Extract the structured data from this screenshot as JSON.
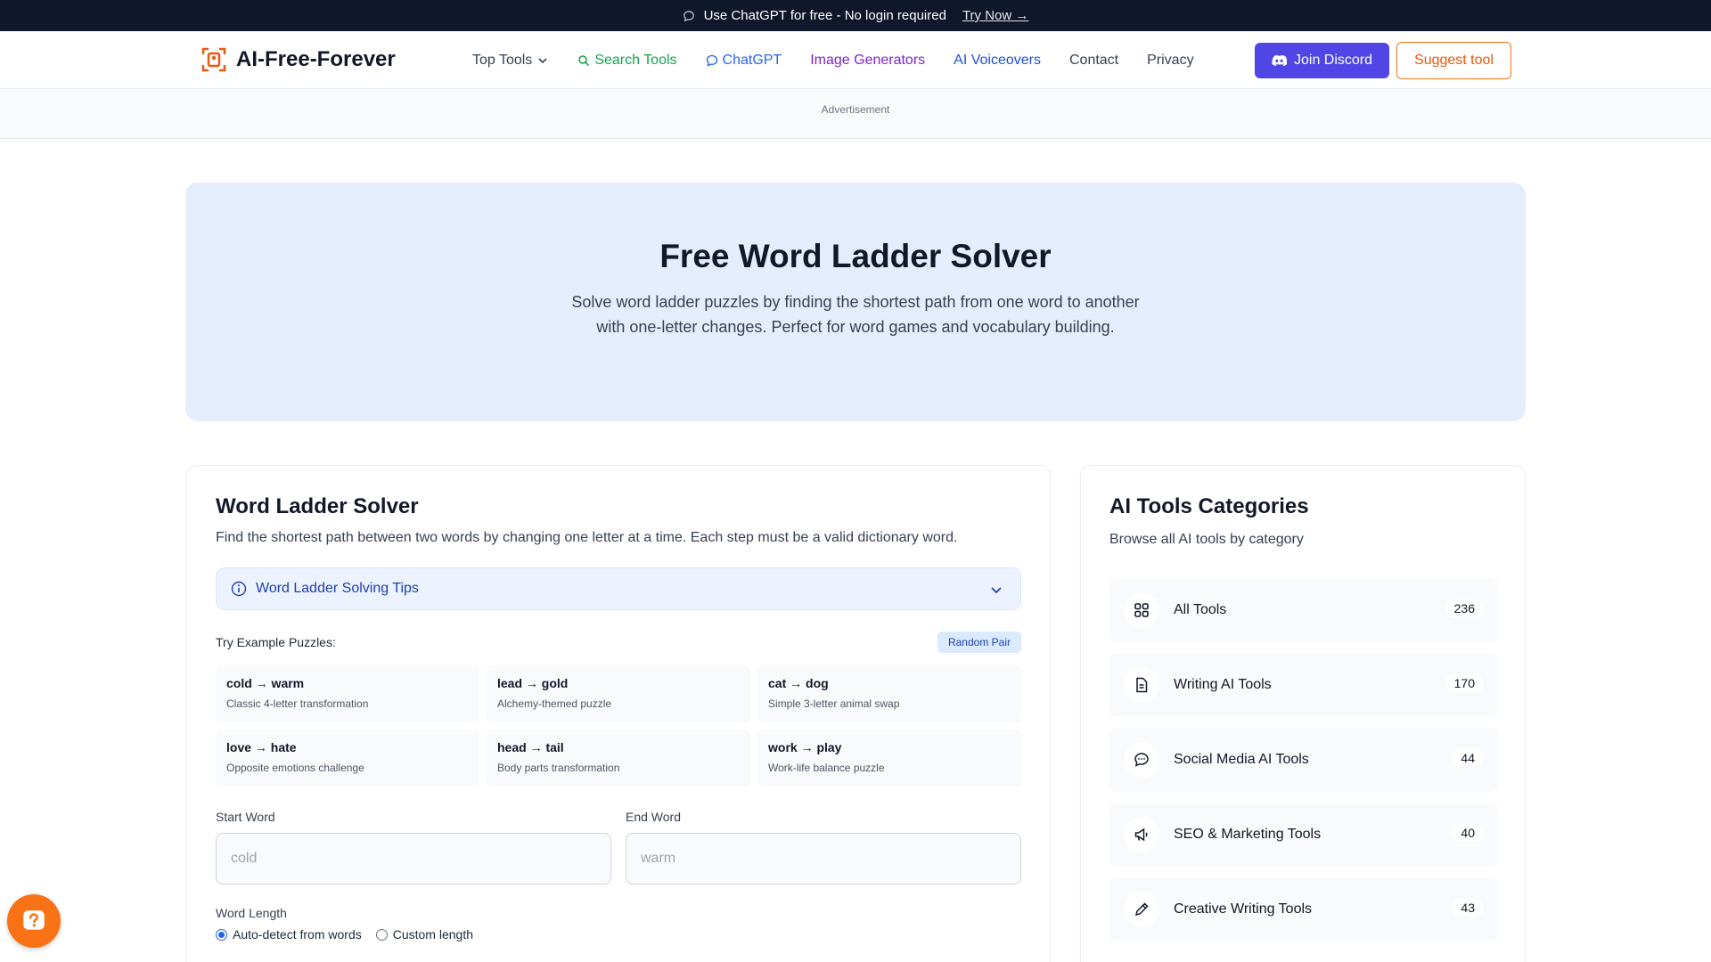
{
  "banner": {
    "text": "Use ChatGPT for free - No login required",
    "link": "Try Now →"
  },
  "nav": {
    "logo": "AI-Free-Forever",
    "links": [
      {
        "label": "Top Tools",
        "color": "#374151"
      },
      {
        "label": "Search Tools",
        "color": "#16a34a"
      },
      {
        "label": "ChatGPT",
        "color": "#2563eb"
      },
      {
        "label": "Image Generators",
        "color": "#7e22ce"
      },
      {
        "label": "AI Voiceovers",
        "color": "#1d4ed8"
      },
      {
        "label": "Contact",
        "color": "#374151"
      },
      {
        "label": "Privacy",
        "color": "#374151"
      }
    ],
    "discord": "Join Discord",
    "suggest": "Suggest tool"
  },
  "ad": {
    "label": "Advertisement"
  },
  "hero": {
    "title": "Free Word Ladder Solver",
    "subtitle": "Solve word ladder puzzles by finding the shortest path from one word to another with one-letter changes. Perfect for word games and vocabulary building."
  },
  "solver": {
    "title": "Word Ladder Solver",
    "description": "Find the shortest path between two words by changing one letter at a time. Each step must be a valid dictionary word.",
    "tips": "Word Ladder Solving Tips",
    "examples_label": "Try Example Puzzles:",
    "random": "Random Pair",
    "examples": [
      {
        "title": "cold → warm",
        "sub": "Classic 4-letter transformation"
      },
      {
        "title": "lead → gold",
        "sub": "Alchemy-themed puzzle"
      },
      {
        "title": "cat → dog",
        "sub": "Simple 3-letter animal swap"
      },
      {
        "title": "love → hate",
        "sub": "Opposite emotions challenge"
      },
      {
        "title": "head → tail",
        "sub": "Body parts transformation"
      },
      {
        "title": "work → play",
        "sub": "Work-life balance puzzle"
      }
    ],
    "start_label": "Start Word",
    "start_placeholder": "cold",
    "end_label": "End Word",
    "end_placeholder": "warm",
    "length_label": "Word Length",
    "radio_auto": "Auto-detect from words",
    "radio_custom": "Custom length"
  },
  "sidebar": {
    "title": "AI Tools Categories",
    "subtitle": "Browse all AI tools by category",
    "categories": [
      {
        "label": "All Tools",
        "count": "236",
        "icon": "grid-icon"
      },
      {
        "label": "Writing AI Tools",
        "count": "170",
        "icon": "document-icon"
      },
      {
        "label": "Social Media AI Tools",
        "count": "44",
        "icon": "chat-bubble-icon"
      },
      {
        "label": "SEO & Marketing Tools",
        "count": "40",
        "icon": "megaphone-icon"
      },
      {
        "label": "Creative Writing Tools",
        "count": "43",
        "icon": "pencil-icon"
      }
    ]
  },
  "colors": {
    "accent": "#4f46e5",
    "brand_orange": "#f97316",
    "hero_bg": "#e3edfc"
  }
}
